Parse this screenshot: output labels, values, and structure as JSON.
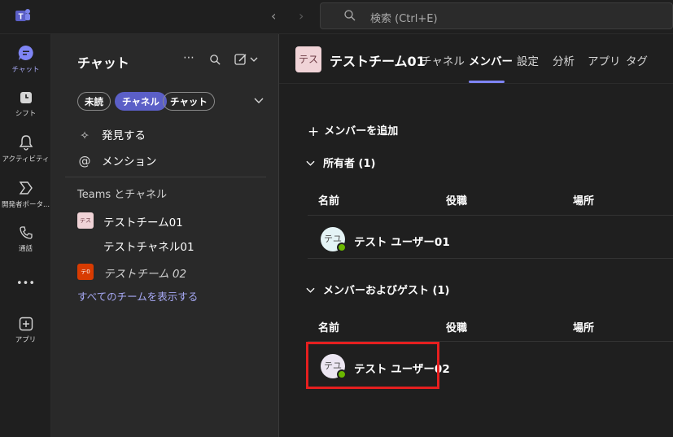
{
  "titlebar": {
    "search_placeholder": "検索 (Ctrl+E)"
  },
  "rail": {
    "items": [
      {
        "label": "チャット",
        "icon": "chat-icon"
      },
      {
        "label": "シフト",
        "icon": "shifts-icon"
      },
      {
        "label": "アクティビティ",
        "icon": "bell-icon"
      },
      {
        "label": "開発者ポータ...",
        "icon": "developer-portal-icon"
      },
      {
        "label": "通話",
        "icon": "phone-icon"
      },
      {
        "label": "•••",
        "icon": "more-icon"
      },
      {
        "label": "アプリ",
        "icon": "apps-add-icon"
      }
    ]
  },
  "pane": {
    "title": "チャット",
    "filters": [
      "未読",
      "チャネル",
      "チャット"
    ],
    "discover": "発見する",
    "mentions": "メンション",
    "section_label": "Teams とチャネル",
    "teams": [
      {
        "avatar": "テス",
        "name": "テストチーム01",
        "channel": "テストチャネル01"
      },
      {
        "avatar": "テ0",
        "name": "テストチーム 02"
      }
    ],
    "show_all": "すべてのチームを表示する"
  },
  "main": {
    "team_badge": "テス",
    "team_name": "テストチーム01",
    "tabs": [
      "チャネル",
      "メンバー",
      "設定",
      "分析",
      "アプリ",
      "タグ"
    ],
    "add_member": "メンバーを追加",
    "groups": [
      {
        "title": "所有者 (1)",
        "columns": [
          "名前",
          "役職",
          "場所"
        ],
        "members": [
          {
            "initials": "テユ",
            "name": "テスト ユーザー01"
          }
        ]
      },
      {
        "title": "メンバーおよびゲスト (1)",
        "columns": [
          "名前",
          "役職",
          "場所"
        ],
        "members": [
          {
            "initials": "テユ",
            "name": "テスト ユーザー02"
          }
        ]
      }
    ]
  },
  "colors": {
    "accent": "#5b5fc7",
    "link": "#a7a9f5",
    "presence_available": "#6bb700",
    "highlight": "#e51f1f"
  }
}
